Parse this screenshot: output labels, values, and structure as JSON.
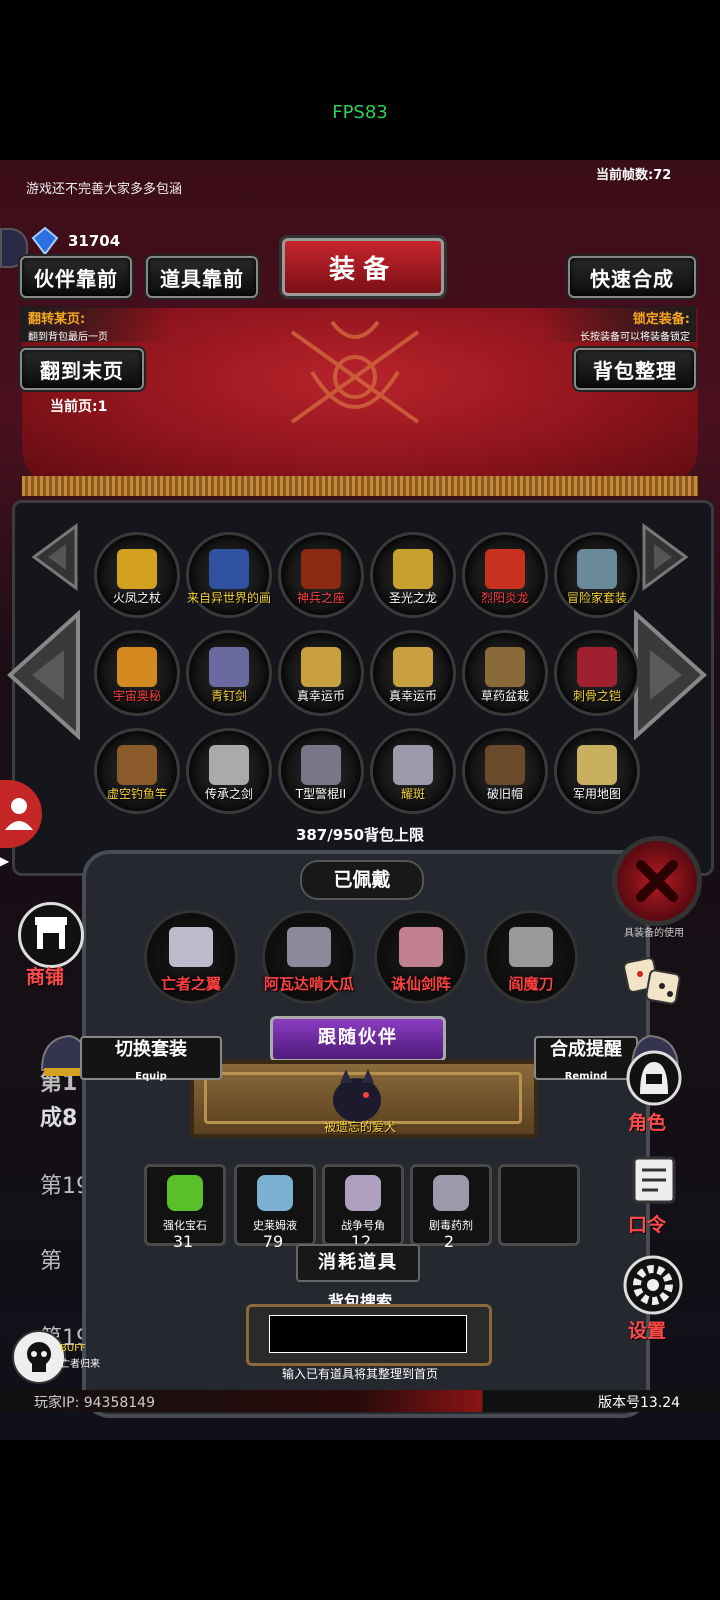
{
  "status": {
    "fps": "FPS83"
  },
  "top": {
    "notice": "游戏还不完善大家多多包涵",
    "frame_rate": "当前帧数:72",
    "gem_count": "31704"
  },
  "header": {
    "title": "装备",
    "partner_first": "伙伴靠前",
    "item_first": "道具靠前",
    "quick_merge": "快速合成"
  },
  "page_control": {
    "flip_title": "翻转某页:",
    "flip_desc": "翻到背包最后一页",
    "flip_button": "翻到末页",
    "current_page": "当前页:1",
    "lock_title": "锁定装备:",
    "lock_desc": "长按装备可以将装备锁定",
    "sort_button": "背包整理"
  },
  "inventory": {
    "items": [
      {
        "label": "火凤之杖",
        "color": "#ffffff",
        "icon": "staff-icon"
      },
      {
        "label": "来自异世界的画",
        "color": "#f5d23a",
        "icon": "painting-icon"
      },
      {
        "label": "神兵之座",
        "color": "#ff4040",
        "icon": "pedestal-icon"
      },
      {
        "label": "圣光之龙",
        "color": "#ffffff",
        "icon": "dragon-icon"
      },
      {
        "label": "烈阳炎龙",
        "color": "#ff4040",
        "icon": "fire-dragon-icon"
      },
      {
        "label": "冒险家套装",
        "color": "#f5d23a",
        "icon": "adventurer-set-icon"
      },
      {
        "label": "宇宙奥秘",
        "color": "#ff4040",
        "icon": "tome-icon"
      },
      {
        "label": "青钉剑",
        "color": "#f5d23a",
        "icon": "sword-icon"
      },
      {
        "label": "真幸运币",
        "color": "#ffffff",
        "icon": "coin-icon"
      },
      {
        "label": "真幸运币",
        "color": "#ffffff",
        "icon": "coin-icon"
      },
      {
        "label": "草药盆栽",
        "color": "#ffffff",
        "icon": "plant-icon"
      },
      {
        "label": "刺骨之铠",
        "color": "#f5d23a",
        "icon": "armor-icon"
      },
      {
        "label": "虚空钓鱼竿",
        "color": "#f5d23a",
        "icon": "fishing-rod-icon"
      },
      {
        "label": "传承之剑",
        "color": "#ffffff",
        "icon": "dagger-icon"
      },
      {
        "label": "T型警棍II",
        "color": "#ffffff",
        "icon": "baton-icon"
      },
      {
        "label": "耀斑",
        "color": "#f5d23a",
        "icon": "flare-icon"
      },
      {
        "label": "破旧帽",
        "color": "#ffffff",
        "icon": "hat-icon"
      },
      {
        "label": "军用地图",
        "color": "#ffffff",
        "icon": "map-icon"
      }
    ],
    "capacity": "387/950背包上限"
  },
  "equipped": {
    "title": "已佩戴",
    "items": [
      {
        "label": "亡者之翼",
        "icon": "bone-wings-icon"
      },
      {
        "label": "阿瓦达啃大瓜",
        "icon": "scepter-icon"
      },
      {
        "label": "诛仙剑阵",
        "icon": "sword-fan-icon"
      },
      {
        "label": "阎魔刀",
        "icon": "katana-icon"
      }
    ]
  },
  "companion": {
    "title": "跟随伙伴",
    "name": "被遗忘的爱犬",
    "switch_set": "切换套装",
    "switch_set_sub": "Equip",
    "merge_remind": "合成提醒",
    "merge_remind_sub": "Remind"
  },
  "consumables": {
    "title": "消耗道具",
    "items": [
      {
        "label": "强化宝石",
        "count": "31",
        "icon": "gem-icon"
      },
      {
        "label": "史莱姆液",
        "count": "79",
        "icon": "potion-icon"
      },
      {
        "label": "战争号角",
        "count": "12",
        "icon": "horn-icon"
      },
      {
        "label": "剧毒药剂",
        "count": "2",
        "icon": "poison-icon"
      }
    ]
  },
  "search": {
    "title": "背包搜索",
    "hint": "输入已有道具将其整理到首页",
    "value": ""
  },
  "sidebar": {
    "shop": "商铺",
    "role": "角色",
    "code": "口令",
    "settings": "设置",
    "use_hint": "具装备的使用"
  },
  "background_log": {
    "line1": "第1",
    "line2": "成8",
    "line3": "第19",
    "line4": "第",
    "line5": "第19881回:隐秘的"
  },
  "buff": {
    "label": "BUFF",
    "name": "亡者归来"
  },
  "footer": {
    "player_ip": "玩家IP: 94358149",
    "version": "版本号13.24"
  }
}
